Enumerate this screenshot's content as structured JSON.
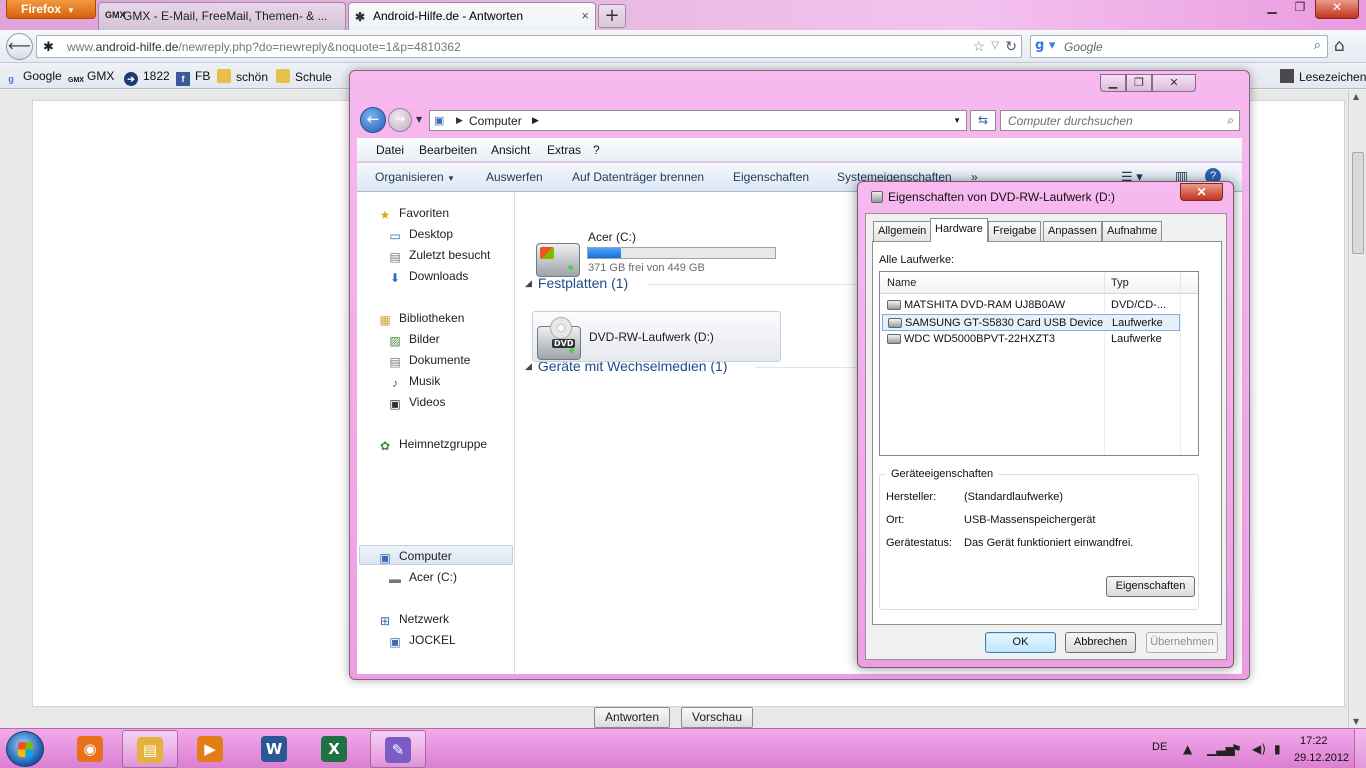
{
  "firefox": {
    "button_label": "Firefox",
    "tabs": [
      {
        "label": "GMX - E-Mail, FreeMail, Themen- & ...",
        "favicon": "GMX"
      },
      {
        "label": "Android-Hilfe.de - Antworten"
      }
    ],
    "url_prefix": "www.",
    "url_domain": "android-hilfe.de",
    "url_path": "/newreply.php?do=newreply&noquote=1&p=4810362",
    "search_placeholder": "Google",
    "bookmarks": [
      {
        "label": "Google",
        "icon": "g"
      },
      {
        "label": "GMX",
        "icon": "GMX"
      },
      {
        "label": "1822",
        "icon": "➔"
      },
      {
        "label": "FB",
        "icon": "f"
      },
      {
        "label": "schön",
        "icon": ""
      },
      {
        "label": "Schule",
        "icon": ""
      }
    ],
    "bookmarks_menu_label": "Lesezeichen"
  },
  "page": {
    "submit_label": "Antworten",
    "preview_label": "Vorschau"
  },
  "explorer": {
    "address_path": "Computer",
    "search_placeholder": "Computer durchsuchen",
    "menu": [
      "Datei",
      "Bearbeiten",
      "Ansicht",
      "Extras",
      "?"
    ],
    "commands": [
      "Organisieren",
      "Auswerfen",
      "Auf Datenträger brennen",
      "Eigenschaften",
      "Systemeigenschaften",
      "»"
    ],
    "nav": {
      "favorites": "Favoriten",
      "desktop": "Desktop",
      "recent": "Zuletzt besucht",
      "downloads": "Downloads",
      "libraries": "Bibliotheken",
      "pictures": "Bilder",
      "documents": "Dokumente",
      "music": "Musik",
      "videos": "Videos",
      "homegroup": "Heimnetzgruppe",
      "computer": "Computer",
      "acer": "Acer (C:)",
      "network": "Netzwerk",
      "jockel": "JOCKEL"
    },
    "sections": {
      "hard_disks": "Festplatten (1)",
      "removable": "Geräte mit Wechselmedien (1)"
    },
    "drive_c": {
      "name": "Acer (C:)",
      "free_text": "371 GB frei von 449 GB",
      "used_fraction": 0.174
    },
    "drive_d": {
      "name": "DVD-RW-Laufwerk (D:)",
      "label": "DVD"
    }
  },
  "dialog": {
    "title": "Eigenschaften von DVD-RW-Laufwerk (D:)",
    "tabs": [
      "Allgemein",
      "Hardware",
      "Freigabe",
      "Anpassen",
      "Aufnahme"
    ],
    "active_tab": "Hardware",
    "all_drives_label": "Alle Laufwerke:",
    "columns": [
      "Name",
      "Typ"
    ],
    "drives": [
      {
        "name": "MATSHITA DVD-RAM UJ8B0AW",
        "type": "DVD/CD-..."
      },
      {
        "name": "SAMSUNG GT-S5830 Card USB Device",
        "type": "Laufwerke"
      },
      {
        "name": "WDC WD5000BPVT-22HXZT3",
        "type": "Laufwerke"
      }
    ],
    "selected_drive_index": 1,
    "device_props_title": "Geräteeigenschaften",
    "props": [
      {
        "label": "Hersteller:",
        "value": "(Standardlaufwerke)"
      },
      {
        "label": "Ort:",
        "value": "USB-Massenspeichergerät"
      },
      {
        "label": "Gerätestatus:",
        "value": "Das Gerät funktioniert einwandfrei."
      }
    ],
    "properties_button": "Eigenschaften",
    "ok": "OK",
    "cancel": "Abbrechen",
    "apply": "Übernehmen"
  },
  "taskbar": {
    "apps": [
      {
        "name": "firefox",
        "glyph": "◉",
        "color": "#e8701a"
      },
      {
        "name": "explorer",
        "glyph": "▤",
        "color": "#e3b23c"
      },
      {
        "name": "media-player",
        "glyph": "▶",
        "color": "#e27e15"
      },
      {
        "name": "word",
        "glyph": "W",
        "color": "#2b5797"
      },
      {
        "name": "excel",
        "glyph": "X",
        "color": "#1e7145"
      },
      {
        "name": "paint",
        "glyph": "✎",
        "color": "#7a5cc4"
      }
    ],
    "language": "DE",
    "time": "17:22",
    "date": "29.12.2012"
  }
}
